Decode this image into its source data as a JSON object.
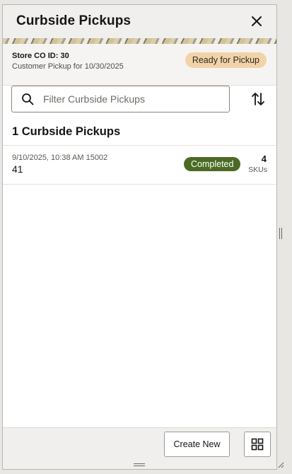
{
  "header": {
    "title": "Curbside Pickups"
  },
  "store": {
    "id_label": "Store CO ID: 30",
    "subtitle": "Customer Pickup for 10/30/2025",
    "status": "Ready for Pickup"
  },
  "search": {
    "placeholder": "Filter Curbside Pickups",
    "value": ""
  },
  "list": {
    "count_title": "1 Curbside Pickups",
    "items": [
      {
        "meta": "9/10/2025, 10:38 AM 15002",
        "id": "41",
        "status": "Completed",
        "sku_count": "4",
        "sku_label": "SKUs"
      }
    ]
  },
  "footer": {
    "create_label": "Create New"
  },
  "icons": {
    "close": "close-icon",
    "search": "search-icon",
    "sort": "sort-icon",
    "grid": "grid-icon"
  },
  "colors": {
    "ready_badge": "#f2d3a8",
    "completed_badge": "#4b6b25",
    "header_bg": "#f1efed"
  }
}
